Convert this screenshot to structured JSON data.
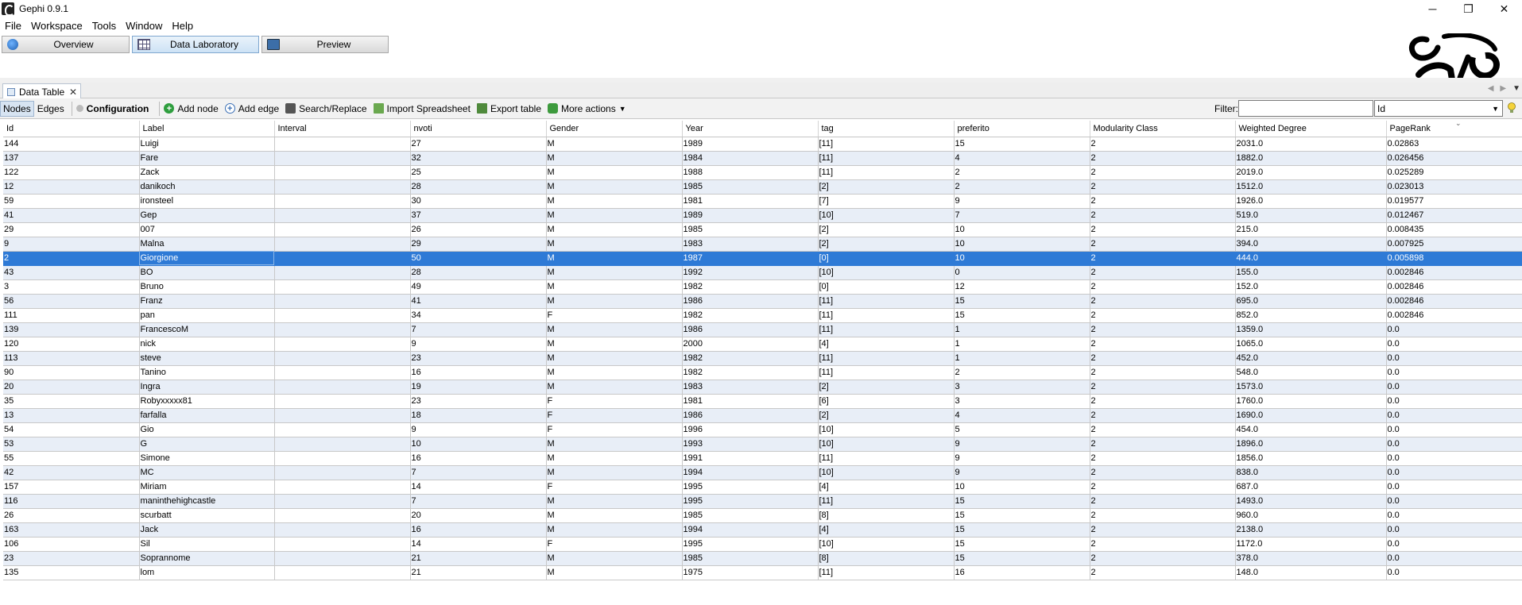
{
  "window": {
    "title": "Gephi 0.9.1",
    "controls": [
      "─",
      "❐",
      "✕"
    ]
  },
  "menu": [
    "File",
    "Workspace",
    "Tools",
    "Window",
    "Help"
  ],
  "perspectives": {
    "overview": "Overview",
    "data_lab": "Data Laboratory",
    "preview": "Preview"
  },
  "tab": {
    "label": "Data Table",
    "close": "✕"
  },
  "toolbar": {
    "nodes": "Nodes",
    "edges": "Edges",
    "configuration": "Configuration",
    "add_node": "Add node",
    "add_edge": "Add edge",
    "search_replace": "Search/Replace",
    "import_spreadsheet": "Import Spreadsheet",
    "export_table": "Export table",
    "more_actions": "More actions",
    "filter_label": "Filter:",
    "filter_value": "",
    "filter_column": "Id"
  },
  "table": {
    "columns": [
      "Id",
      "Label",
      "Interval",
      "nvoti",
      "Gender",
      "Year",
      "tag",
      "preferito",
      "Modularity Class",
      "Weighted Degree",
      "PageRank"
    ],
    "selected_row": 7,
    "rows": [
      [
        "144",
        "Luigi",
        "",
        "27",
        "M",
        "1989",
        "[11]",
        "15",
        "2",
        "2031.0",
        "0.02863"
      ],
      [
        "137",
        "Fare",
        "",
        "32",
        "M",
        "1984",
        "[11]",
        "4",
        "2",
        "1882.0",
        "0.026456"
      ],
      [
        "122",
        "Zack",
        "",
        "25",
        "M",
        "1988",
        "[11]",
        "2",
        "2",
        "2019.0",
        "0.025289"
      ],
      [
        "12",
        "danikoch",
        "",
        "28",
        "M",
        "1985",
        "[2]",
        "2",
        "2",
        "1512.0",
        "0.023013"
      ],
      [
        "59",
        "ironsteel",
        "",
        "30",
        "M",
        "1981",
        "[7]",
        "9",
        "2",
        "1926.0",
        "0.019577"
      ],
      [
        "41",
        "Gep",
        "",
        "37",
        "M",
        "1989",
        "[10]",
        "7",
        "2",
        "519.0",
        "0.012467"
      ],
      [
        "29",
        "007",
        "",
        "26",
        "M",
        "1985",
        "[2]",
        "10",
        "2",
        "215.0",
        "0.008435"
      ],
      [
        "9",
        "Malna",
        "",
        "29",
        "M",
        "1983",
        "[2]",
        "10",
        "2",
        "394.0",
        "0.007925"
      ],
      [
        "2",
        "Giorgione",
        "",
        "50",
        "M",
        "1987",
        "[0]",
        "10",
        "2",
        "444.0",
        "0.005898"
      ],
      [
        "43",
        "BO",
        "",
        "28",
        "M",
        "1992",
        "[10]",
        "0",
        "2",
        "155.0",
        "0.002846"
      ],
      [
        "3",
        "Bruno",
        "",
        "49",
        "M",
        "1982",
        "[0]",
        "12",
        "2",
        "152.0",
        "0.002846"
      ],
      [
        "56",
        "Franz",
        "",
        "41",
        "M",
        "1986",
        "[11]",
        "15",
        "2",
        "695.0",
        "0.002846"
      ],
      [
        "111",
        "pan",
        "",
        "34",
        "F",
        "1982",
        "[11]",
        "15",
        "2",
        "852.0",
        "0.002846"
      ],
      [
        "139",
        "FrancescoM",
        "",
        "7",
        "M",
        "1986",
        "[11]",
        "1",
        "2",
        "1359.0",
        "0.0"
      ],
      [
        "120",
        "nick",
        "",
        "9",
        "M",
        "2000",
        "[4]",
        "1",
        "2",
        "1065.0",
        "0.0"
      ],
      [
        "113",
        "steve",
        "",
        "23",
        "M",
        "1982",
        "[11]",
        "1",
        "2",
        "452.0",
        "0.0"
      ],
      [
        "90",
        "Tanino",
        "",
        "16",
        "M",
        "1982",
        "[11]",
        "2",
        "2",
        "548.0",
        "0.0"
      ],
      [
        "20",
        "Ingra",
        "",
        "19",
        "M",
        "1983",
        "[2]",
        "3",
        "2",
        "1573.0",
        "0.0"
      ],
      [
        "35",
        "Robyxxxxx81",
        "",
        "23",
        "F",
        "1981",
        "[6]",
        "3",
        "2",
        "1760.0",
        "0.0"
      ],
      [
        "13",
        "farfalla",
        "",
        "18",
        "F",
        "1986",
        "[2]",
        "4",
        "2",
        "1690.0",
        "0.0"
      ],
      [
        "54",
        "Gio",
        "",
        "9",
        "F",
        "1996",
        "[10]",
        "5",
        "2",
        "454.0",
        "0.0"
      ],
      [
        "53",
        "G",
        "",
        "10",
        "M",
        "1993",
        "[10]",
        "9",
        "2",
        "1896.0",
        "0.0"
      ],
      [
        "55",
        "Simone",
        "",
        "16",
        "M",
        "1991",
        "[11]",
        "9",
        "2",
        "1856.0",
        "0.0"
      ],
      [
        "42",
        "MC",
        "",
        "7",
        "M",
        "1994",
        "[10]",
        "9",
        "2",
        "838.0",
        "0.0"
      ],
      [
        "157",
        "Miriam",
        "",
        "14",
        "F",
        "1995",
        "[4]",
        "10",
        "2",
        "687.0",
        "0.0"
      ],
      [
        "116",
        "maninthehighcastle",
        "",
        "7",
        "M",
        "1995",
        "[11]",
        "15",
        "2",
        "1493.0",
        "0.0"
      ],
      [
        "26",
        "scurbatt",
        "",
        "20",
        "M",
        "1985",
        "[8]",
        "15",
        "2",
        "960.0",
        "0.0"
      ],
      [
        "163",
        "Jack",
        "",
        "16",
        "M",
        "1994",
        "[4]",
        "15",
        "2",
        "2138.0",
        "0.0"
      ],
      [
        "106",
        "Sil",
        "",
        "14",
        "F",
        "1995",
        "[10]",
        "15",
        "2",
        "1172.0",
        "0.0"
      ],
      [
        "23",
        "Soprannome",
        "",
        "21",
        "M",
        "1985",
        "[8]",
        "15",
        "2",
        "378.0",
        "0.0"
      ],
      [
        "135",
        "lom",
        "",
        "21",
        "M",
        "1975",
        "[11]",
        "16",
        "2",
        "148.0",
        "0.0"
      ]
    ]
  }
}
